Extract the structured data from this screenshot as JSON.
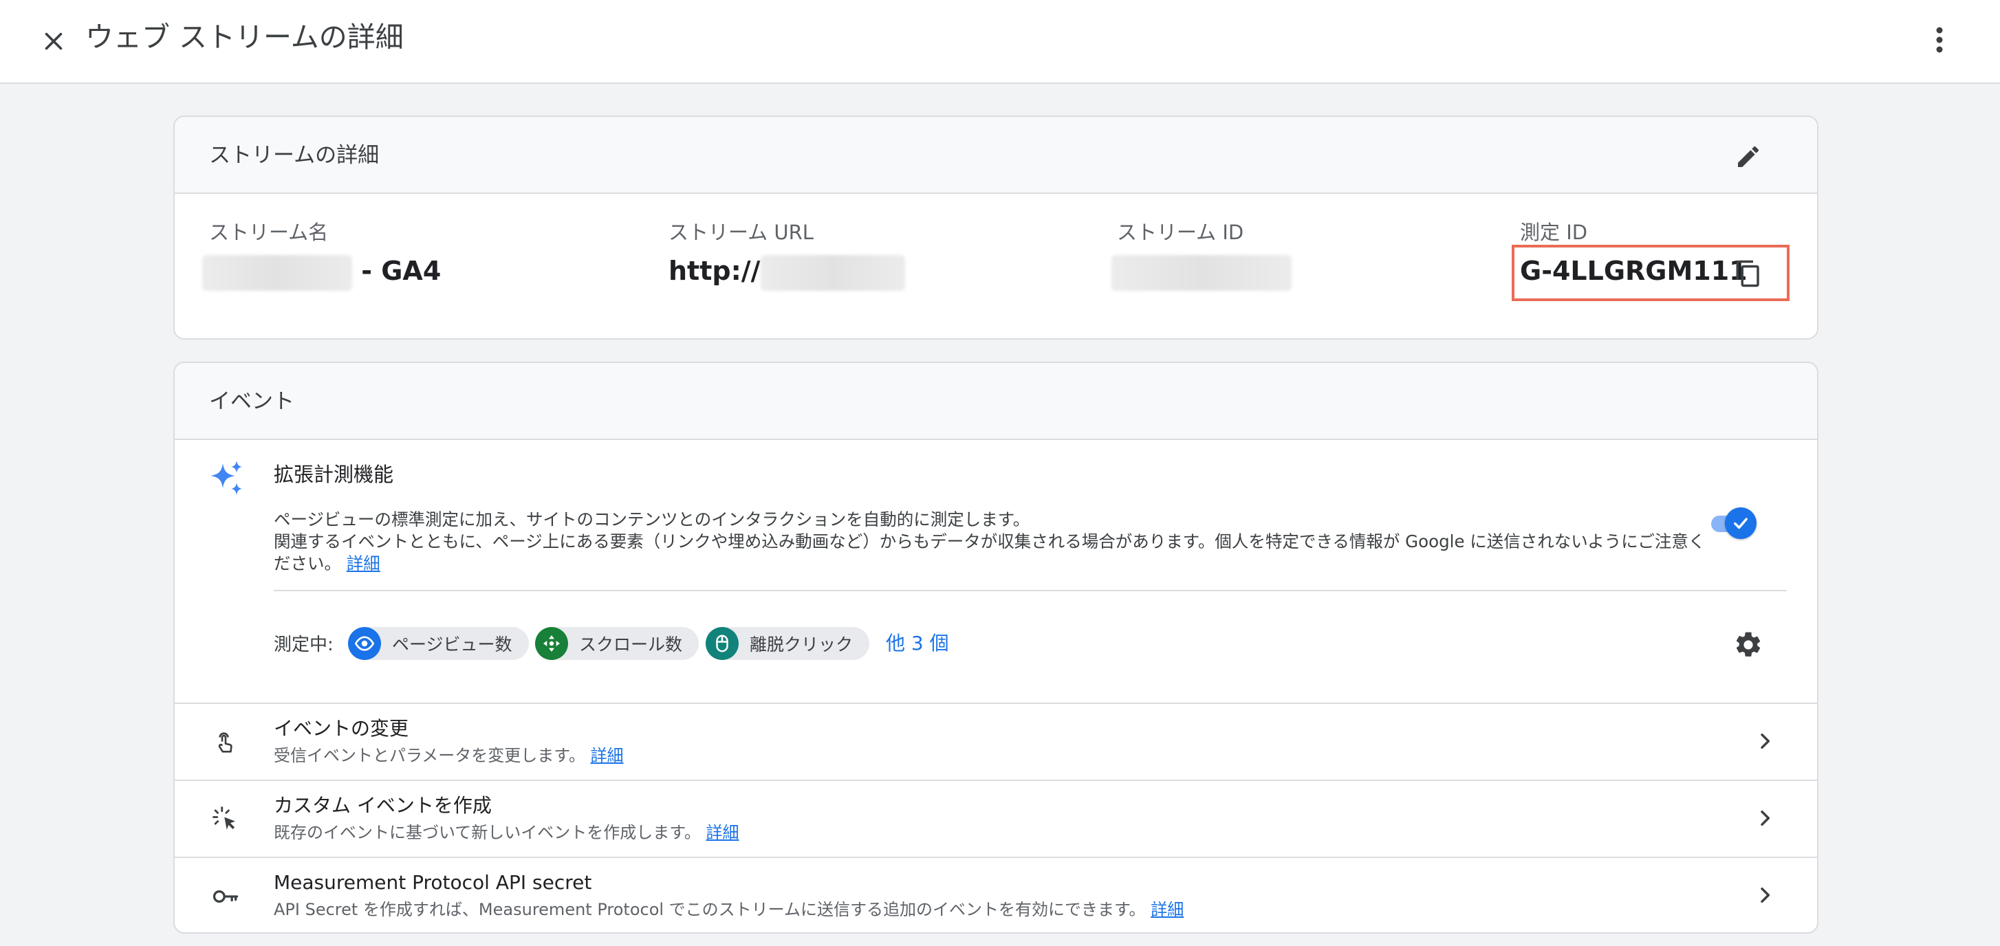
{
  "header": {
    "title": "ウェブ ストリームの詳細"
  },
  "stream_details": {
    "card_title": "ストリームの詳細",
    "fields": [
      {
        "label": "ストリーム名",
        "value_suffix": "- GA4"
      },
      {
        "label": "ストリーム URL",
        "value_prefix": "http://"
      },
      {
        "label": "ストリーム ID"
      },
      {
        "label": "測定 ID",
        "value": "G-4LLGRGM111"
      }
    ]
  },
  "events": {
    "card_title": "イベント",
    "enhanced_measurement": {
      "title": "拡張計測機能",
      "desc_line1": "ページビューの標準測定に加え、サイトのコンテンツとのインタラクションを自動的に測定します。",
      "desc_line2": "関連するイベントとともに、ページ上にある要素（リンクや埋め込み動画など）からもデータが収集される場合があります。個人を特定できる情報が Google に送信されないようにご注意ください。",
      "learn_more": "詳細",
      "toggle_on": true,
      "measuring_label": "測定中:",
      "chips": [
        {
          "label": "ページビュー数",
          "icon": "eye-icon",
          "color": "#1a73e8"
        },
        {
          "label": "スクロール数",
          "icon": "scroll-icon",
          "color": "#188038"
        },
        {
          "label": "離脱クリック",
          "icon": "mouse-icon",
          "color": "#12837a"
        }
      ],
      "more": "他 3 個"
    },
    "rows": [
      {
        "title": "イベントの変更",
        "subtitle": "受信イベントとパラメータを変更します。",
        "link": "詳細",
        "icon": "touch-icon"
      },
      {
        "title": "カスタム イベントを作成",
        "subtitle": "既存のイベントに基づいて新しいイベントを作成します。",
        "link": "詳細",
        "icon": "click-cursor-icon"
      },
      {
        "title": "Measurement Protocol API secret",
        "subtitle": "API Secret を作成すれば、Measurement Protocol でこのストリームに送信する追加のイベントを有効にできます。",
        "link": "詳細",
        "icon": "key-icon"
      }
    ]
  },
  "colors": {
    "accent": "#1a73e8",
    "highlight_box": "#ea6c55"
  }
}
